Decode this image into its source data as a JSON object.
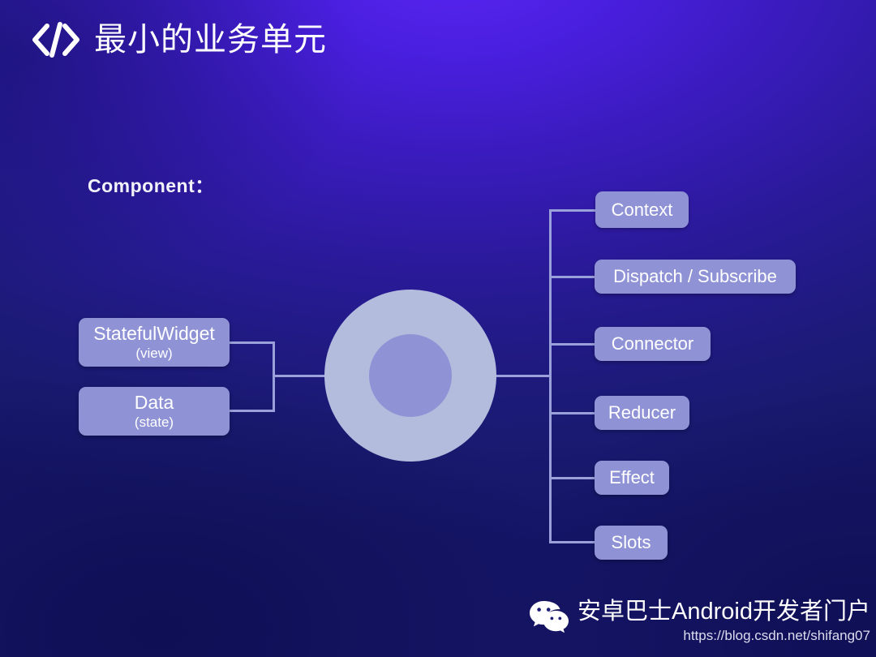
{
  "slide": {
    "background_gradient_from": "#5a25f2",
    "background_gradient_to": "#151567",
    "node_color": "#8f93d6",
    "circle_outer_color": "#b4bcdd",
    "circle_inner_color": "#8f93d6",
    "line_color": "#9aa0da"
  },
  "header": {
    "icon": "code-brackets-icon",
    "title": "最小的业务单元"
  },
  "section": {
    "label": "Component："
  },
  "diagram": {
    "center": {
      "outer_label": "",
      "inner_label": ""
    },
    "left_nodes": [
      {
        "primary": "StatefulWidget",
        "secondary": "(view)"
      },
      {
        "primary": "Data",
        "secondary": "(state)"
      }
    ],
    "right_nodes": [
      {
        "primary": "Context"
      },
      {
        "primary": "Dispatch / Subscribe"
      },
      {
        "primary": "Connector"
      },
      {
        "primary": "Reducer"
      },
      {
        "primary": "Effect"
      },
      {
        "primary": "Slots"
      }
    ]
  },
  "footer": {
    "icon": "wechat-icon",
    "brand": "安卓巴士Android开发者门户",
    "url": "https://blog.csdn.net/shifang07"
  }
}
